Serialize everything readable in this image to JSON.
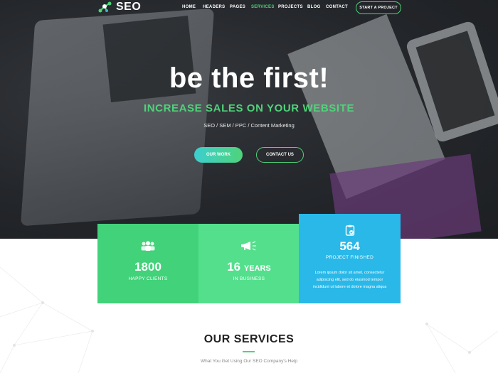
{
  "brand": {
    "name": "SEO",
    "accent": "#4fd37a",
    "blue": "#29b8e8"
  },
  "nav": {
    "items": [
      {
        "label": "HOME"
      },
      {
        "label": "HEADERS"
      },
      {
        "label": "PAGES"
      },
      {
        "label": "SERVICES",
        "active": true
      },
      {
        "label": "PROJECTS"
      },
      {
        "label": "BLOG"
      },
      {
        "label": "CONTACT"
      }
    ],
    "cta_label": "START A PROJECT"
  },
  "hero": {
    "headline": "be the first!",
    "subheadline": "INCREASE SALES ON YOUR WEBSITE",
    "tagline": "SEO / SEM / PPC / Content Marketing",
    "primary_button": "OUR WORK",
    "secondary_button": "CONTACT US"
  },
  "stats": [
    {
      "icon": "users-icon",
      "number": "1800",
      "label": "HAPPY CLIENTS"
    },
    {
      "icon": "megaphone-icon",
      "number": "16",
      "unit": "YEARS",
      "label": "IN BUSINESS"
    },
    {
      "icon": "clipboard-check-icon",
      "number": "564",
      "label": "PROJECT FINISHED",
      "description": "Lorem ipsum dolor sit amet, consectetur adipiscing elit, sed do eiusmod tempor incididunt ut labore et dolore magna aliqua"
    }
  ],
  "services": {
    "title": "OUR SERVICES",
    "subtitle": "What You Get Using Our SEO Company's Help"
  }
}
